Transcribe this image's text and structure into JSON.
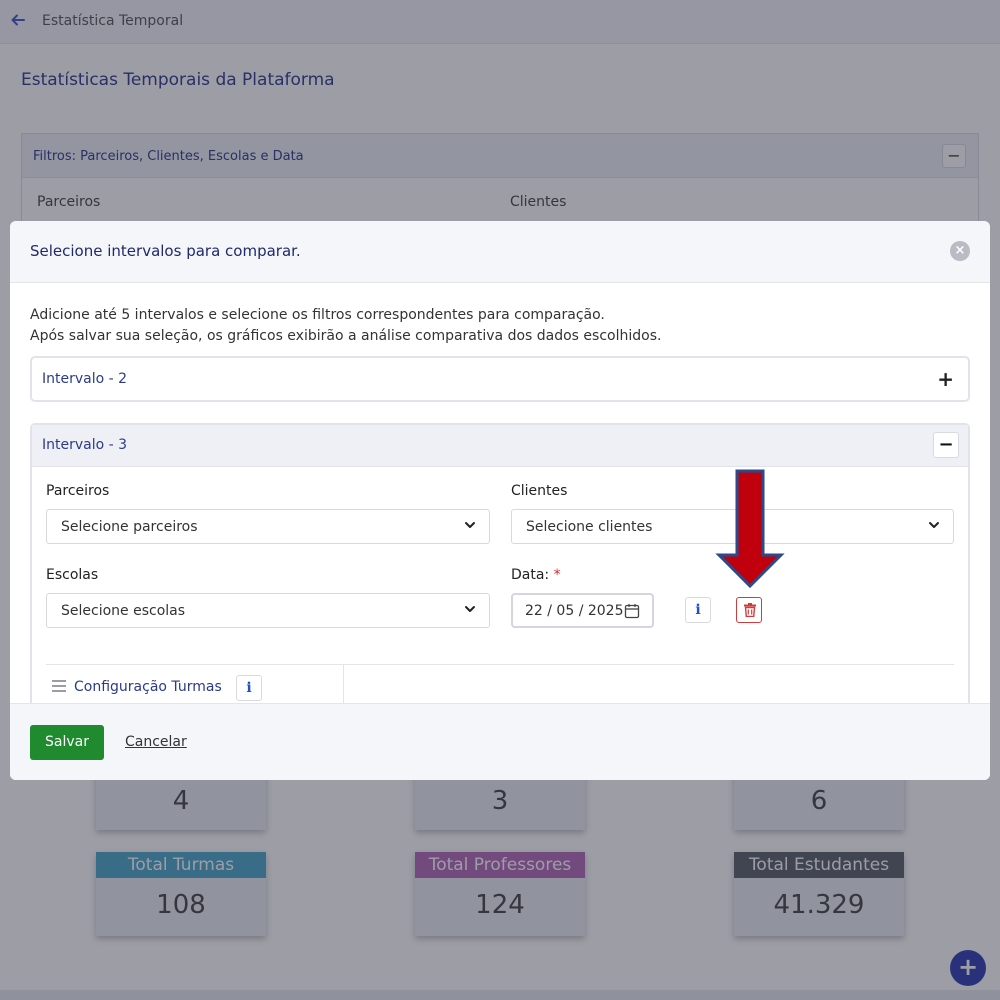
{
  "topbar": {
    "title": "Estatística Temporal",
    "back_icon": "arrow-left-icon"
  },
  "page": {
    "title": "Estatísticas Temporais da Plataforma"
  },
  "filters_card": {
    "title": "Filtros: Parceiros, Clientes, Escolas e Data",
    "toggle": "−",
    "labels": {
      "partners": "Parceiros",
      "clients": "Clientes"
    }
  },
  "stats": {
    "top": [
      "4",
      "3",
      "6"
    ],
    "bottom": [
      {
        "label": "Total Turmas",
        "value": "108",
        "color": "#4aa6c8"
      },
      {
        "label": "Total Professores",
        "value": "124",
        "color": "#b468b8"
      },
      {
        "label": "Total Estudantes",
        "value": "41.329",
        "color": "#5a5e66"
      }
    ]
  },
  "fab": {
    "label": "+"
  },
  "modal": {
    "title": "Selecione intervalos para comparar.",
    "close": "×",
    "intro_line1": "Adicione até 5 intervalos e selecione os filtros correspondentes para comparação.",
    "intro_line2": "Após salvar sua seleção, os gráficos exibirão a análise comparativa dos dados escolhidos.",
    "interval_collapsed": {
      "label": "Intervalo - 2",
      "toggle": "+"
    },
    "interval_open": {
      "label": "Intervalo - 3",
      "toggle": "−",
      "partners_label": "Parceiros",
      "partners_value": "Selecione parceiros",
      "clients_label": "Clientes",
      "clients_value": "Selecione clientes",
      "schools_label": "Escolas",
      "schools_value": "Selecione escolas",
      "date_label": "Data:",
      "date_required": "*",
      "date_value": "22 / 05 / 2025",
      "info": "i",
      "config_label": "Configuração Turmas",
      "config_info": "i"
    },
    "footer": {
      "save": "Salvar",
      "cancel": "Cancelar"
    }
  },
  "colors": {
    "accent": "#2c3a8c",
    "save": "#1f8a2e",
    "danger": "#d23b3b",
    "arrow_fill": "#c0000c",
    "arrow_stroke": "#2b4a8c"
  }
}
